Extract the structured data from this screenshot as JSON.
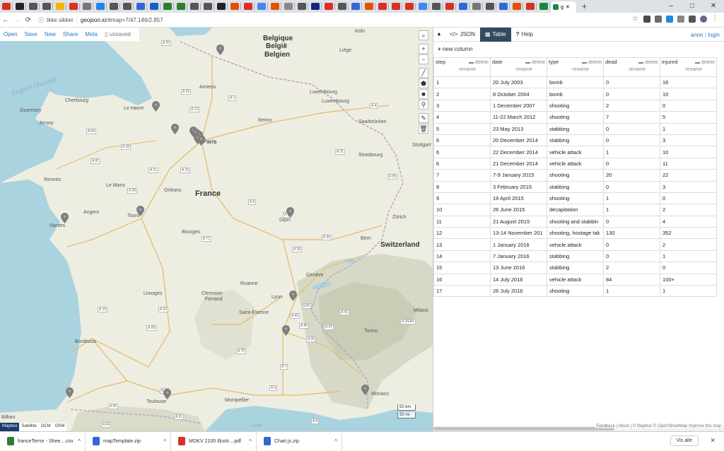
{
  "browser": {
    "active_tab_label": "g",
    "new_tab_label": "+",
    "window_controls": [
      "–",
      "□",
      "✕"
    ],
    "nav": {
      "back": "←",
      "forward": "→",
      "reload": "⟳"
    },
    "security_label": "Ikke sikker",
    "url_host": "geojson.io",
    "url_path": "/#map=7/47.146/2.857",
    "tab_favicon_colors": [
      "#d93025",
      "#222",
      "#555",
      "#555",
      "#f4b400",
      "#d93025",
      "#777",
      "#1e88e5",
      "#555",
      "#555",
      "#3367d6",
      "#1565c0",
      "#2e7d32",
      "#2e7d32",
      "#555",
      "#555",
      "#222",
      "#e65100",
      "#d93025",
      "#4285f4",
      "#e65100",
      "#888",
      "#555",
      "#1a237e",
      "#d93025",
      "#555",
      "#3367d6",
      "#e65100",
      "#d93025",
      "#d93025",
      "#d93025",
      "#4285f4",
      "#555",
      "#d93025",
      "#3367d6",
      "#777",
      "#555",
      "#3367d6",
      "#e65100",
      "#d93025",
      "#1b873b"
    ]
  },
  "map": {
    "toolbar": {
      "open": "Open",
      "save": "Save",
      "new": "New",
      "share": "Share",
      "meta": "Meta",
      "status": "unsaved"
    },
    "labels": {
      "english_channel": "English Channel",
      "belgique": "Belgique",
      "belgie": "België",
      "belgien": "Belgien",
      "france": "France",
      "switzerland": "Switzerland",
      "paris": "Paris",
      "le_havre": "Le Havre",
      "amiens": "Amiens",
      "reims": "Reims",
      "cherbourg": "Cherbourg",
      "guernsey": "Guernsey",
      "jersey": "Jersey",
      "rennes": "Rennes",
      "le_mans": "Le Mans",
      "orleans": "Orléans",
      "tours": "Tours",
      "angers": "Angers",
      "nantes": "Nantes",
      "bourges": "Bourges",
      "dijon": "Dijon",
      "luxembourg": "Luxembourg",
      "luxembourg2": "Luxembourg",
      "koln": "Köln",
      "saarbrucken": "Saarbrücken",
      "strasbourg": "Strasbourg",
      "stuttgart": "Stuttgart",
      "zurich": "Zürich",
      "bern": "Bern",
      "geneve": "Genève",
      "limoges": "Limoges",
      "clermont": "Clermont-",
      "ferrand": "Ferrand",
      "roanne": "Roanne",
      "lyon": "Lyon",
      "saint_etienne": "Saint-Étienne",
      "milano": "Milano",
      "torino": "Torino",
      "bordeaux": "Bordeaux",
      "toulouse": "Toulouse",
      "montpellier": "Montpellier",
      "bilbao": "Bilbao",
      "monaco": "Monaco",
      "golfe": "Golfe",
      "liege": "Liège"
    },
    "roads": [
      "A 25",
      "A 29",
      "A 28",
      "A 1",
      "A 13",
      "A 84",
      "A 11",
      "A 81",
      "A 10",
      "A 28",
      "A 71",
      "A 6",
      "A 31",
      "A 36",
      "A 39",
      "A 4",
      "A 35",
      "A 10",
      "A 20",
      "A 89",
      "A 75",
      "A 7",
      "A 9",
      "A 62",
      "A 63",
      "A 65",
      "A 61",
      "A 8",
      "E25",
      "A 26",
      "A 40",
      "A 41",
      "A 43",
      "A 47",
      "A 26/A4",
      "A 5",
      "A 64"
    ],
    "tools": [
      "search-icon",
      "zoom-in-icon",
      "zoom-out-icon",
      "line-icon",
      "polygon-icon",
      "rectangle-icon",
      "marker-icon",
      "edit-icon",
      "trash-icon"
    ],
    "tool_glyphs": {
      "search": "⌕",
      "zoom_in": "+",
      "zoom_out": "−",
      "line": "╱",
      "polygon": "⬟",
      "rectangle": "■",
      "marker": "⚲",
      "edit": "✎",
      "trash": "🗑"
    },
    "scale": {
      "km": "50 km",
      "mi": "50 mi"
    },
    "layers": [
      "Mapbox",
      "Satellite",
      "OCM",
      "OSM"
    ],
    "attribution": "Feedback | About | © Mapbox © OpenStreetMap Improve this map",
    "pin_color": "#7f7f7f"
  },
  "panel": {
    "tabs": {
      "json": "JSON",
      "table": "Table",
      "help": "Help"
    },
    "tab_icons": {
      "json": "</>",
      "table": "▦",
      "help": "?"
    },
    "collapse": "▲",
    "auth": {
      "anon": "anon",
      "sep": "|",
      "login": "login"
    },
    "new_column": "new column",
    "new_column_icon": "+",
    "delete_label": "delete",
    "rename_label": "rename",
    "columns": [
      "step",
      "date",
      "type",
      "dead",
      "injured"
    ],
    "rows": [
      [
        "1",
        "20 July 2003",
        "bomb",
        "0",
        "16"
      ],
      [
        "2",
        "8 October 2004",
        "bomb",
        "0",
        "10"
      ],
      [
        "3",
        "1 December 2007",
        "shooting",
        "2",
        "0"
      ],
      [
        "4",
        "11-22 March 2012",
        "shooting",
        "7",
        "5"
      ],
      [
        "5",
        "23 May 2013",
        "stabbing",
        "0",
        "1"
      ],
      [
        "6",
        "20 December 2014",
        "stabbing",
        "0",
        "3"
      ],
      [
        "6",
        "22 December 2014",
        "vehicle attack",
        "1",
        "10"
      ],
      [
        "6",
        "21 December 2014",
        "vehicle attack",
        "0",
        "11"
      ],
      [
        "7",
        "7-9 January 2015",
        "shooting",
        "20",
        "22"
      ],
      [
        "8",
        "3 February 2015",
        "stabbing",
        "0",
        "3"
      ],
      [
        "9",
        "19 April 2015",
        "shooting",
        "1",
        "0"
      ],
      [
        "10",
        "26 June 2015",
        "decapitation",
        "1",
        "2"
      ],
      [
        "11",
        "21 August 2015",
        "shooting and stabbin",
        "0",
        "4"
      ],
      [
        "12",
        "13-14 November 201",
        "shooting, hostage tak",
        "130",
        "352"
      ],
      [
        "13",
        "1 January 2016",
        "vehicle attack",
        "0",
        "2"
      ],
      [
        "14",
        "7 January 2016",
        "stabbing",
        "0",
        "1"
      ],
      [
        "15",
        "13 June 2016",
        "stabbing",
        "2",
        "0"
      ],
      [
        "16",
        "14 July 2016",
        "vehicle attack",
        "84",
        "100+"
      ],
      [
        "17",
        "26 July 2016",
        "shooting",
        "1",
        "1"
      ]
    ]
  },
  "downloads": {
    "items": [
      {
        "name": "franceTerror - Shee....csv",
        "color": "#2e7d32"
      },
      {
        "name": "mapTemplate.zip",
        "color": "#3367d6"
      },
      {
        "name": "MOKV 2100 Illustr....pdf",
        "color": "#d93025"
      },
      {
        "name": "Chart.js.zip",
        "color": "#3367d6"
      }
    ],
    "show_all": "Vis alle",
    "close": "✕",
    "caret": "^"
  }
}
